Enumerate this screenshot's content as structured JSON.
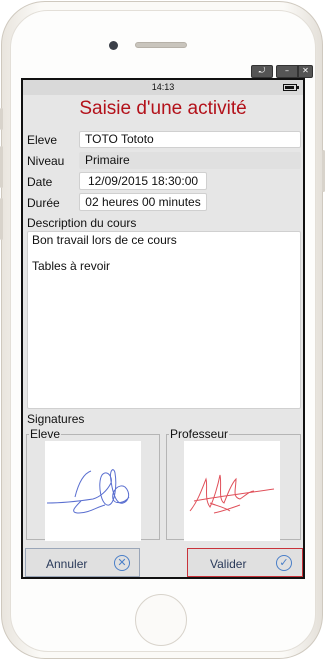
{
  "status_bar": {
    "time": "14:13"
  },
  "window_controls": {
    "restore_glyph": "⤾",
    "minimize_glyph": "–",
    "close_glyph": "✕"
  },
  "form": {
    "title": "Saisie d'une activité",
    "fields": {
      "eleve_label": "Eleve",
      "eleve_value": "TOTO Tototo",
      "niveau_label": "Niveau",
      "niveau_value": "Primaire",
      "date_label": "Date",
      "date_value": "12/09/2015 18:30:00",
      "duree_label": "Durée",
      "duree_value": "02 heures 00 minutes"
    },
    "description": {
      "label": "Description du cours",
      "line1": "Bon travail lors de ce cours",
      "line2": "",
      "line3": "Tables à revoir"
    },
    "signatures": {
      "label": "Signatures",
      "eleve_label": "Eleve",
      "professeur_label": "Professeur",
      "eleve_color": "#5a6fd0",
      "professeur_color": "#e0505a"
    }
  },
  "buttons": {
    "annuler_label": "Annuler",
    "annuler_icon": "close-circle-icon",
    "valider_label": "Valider",
    "valider_icon": "check-circle-icon",
    "valider_border": "#c8323a",
    "icon_color": "#4a7fc8"
  }
}
